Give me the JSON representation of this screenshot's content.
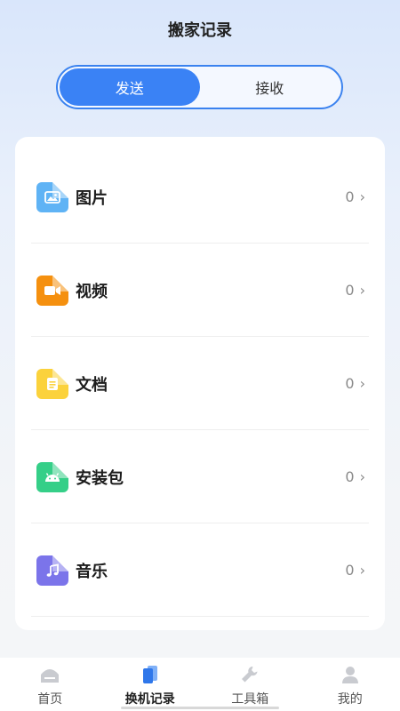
{
  "header": {
    "title": "搬家记录"
  },
  "segment": {
    "tabs": [
      "发送",
      "接收"
    ],
    "active": 0
  },
  "categories": [
    {
      "label": "图片",
      "count": "0",
      "icon": "image-file-icon",
      "color": "#5fb3f5"
    },
    {
      "label": "视频",
      "count": "0",
      "icon": "video-file-icon",
      "color": "#f5900f"
    },
    {
      "label": "文档",
      "count": "0",
      "icon": "document-file-icon",
      "color": "#fbd23c"
    },
    {
      "label": "安装包",
      "count": "0",
      "icon": "android-package-icon",
      "color": "#35cf88"
    },
    {
      "label": "音乐",
      "count": "0",
      "icon": "music-file-icon",
      "color": "#7b74ea"
    }
  ],
  "tabbar": {
    "items": [
      {
        "label": "首页",
        "icon": "home-icon"
      },
      {
        "label": "换机记录",
        "icon": "phone-transfer-icon"
      },
      {
        "label": "工具箱",
        "icon": "wrench-icon"
      },
      {
        "label": "我的",
        "icon": "user-icon"
      }
    ],
    "active": 1
  },
  "colors": {
    "accent": "#3a82f5"
  }
}
